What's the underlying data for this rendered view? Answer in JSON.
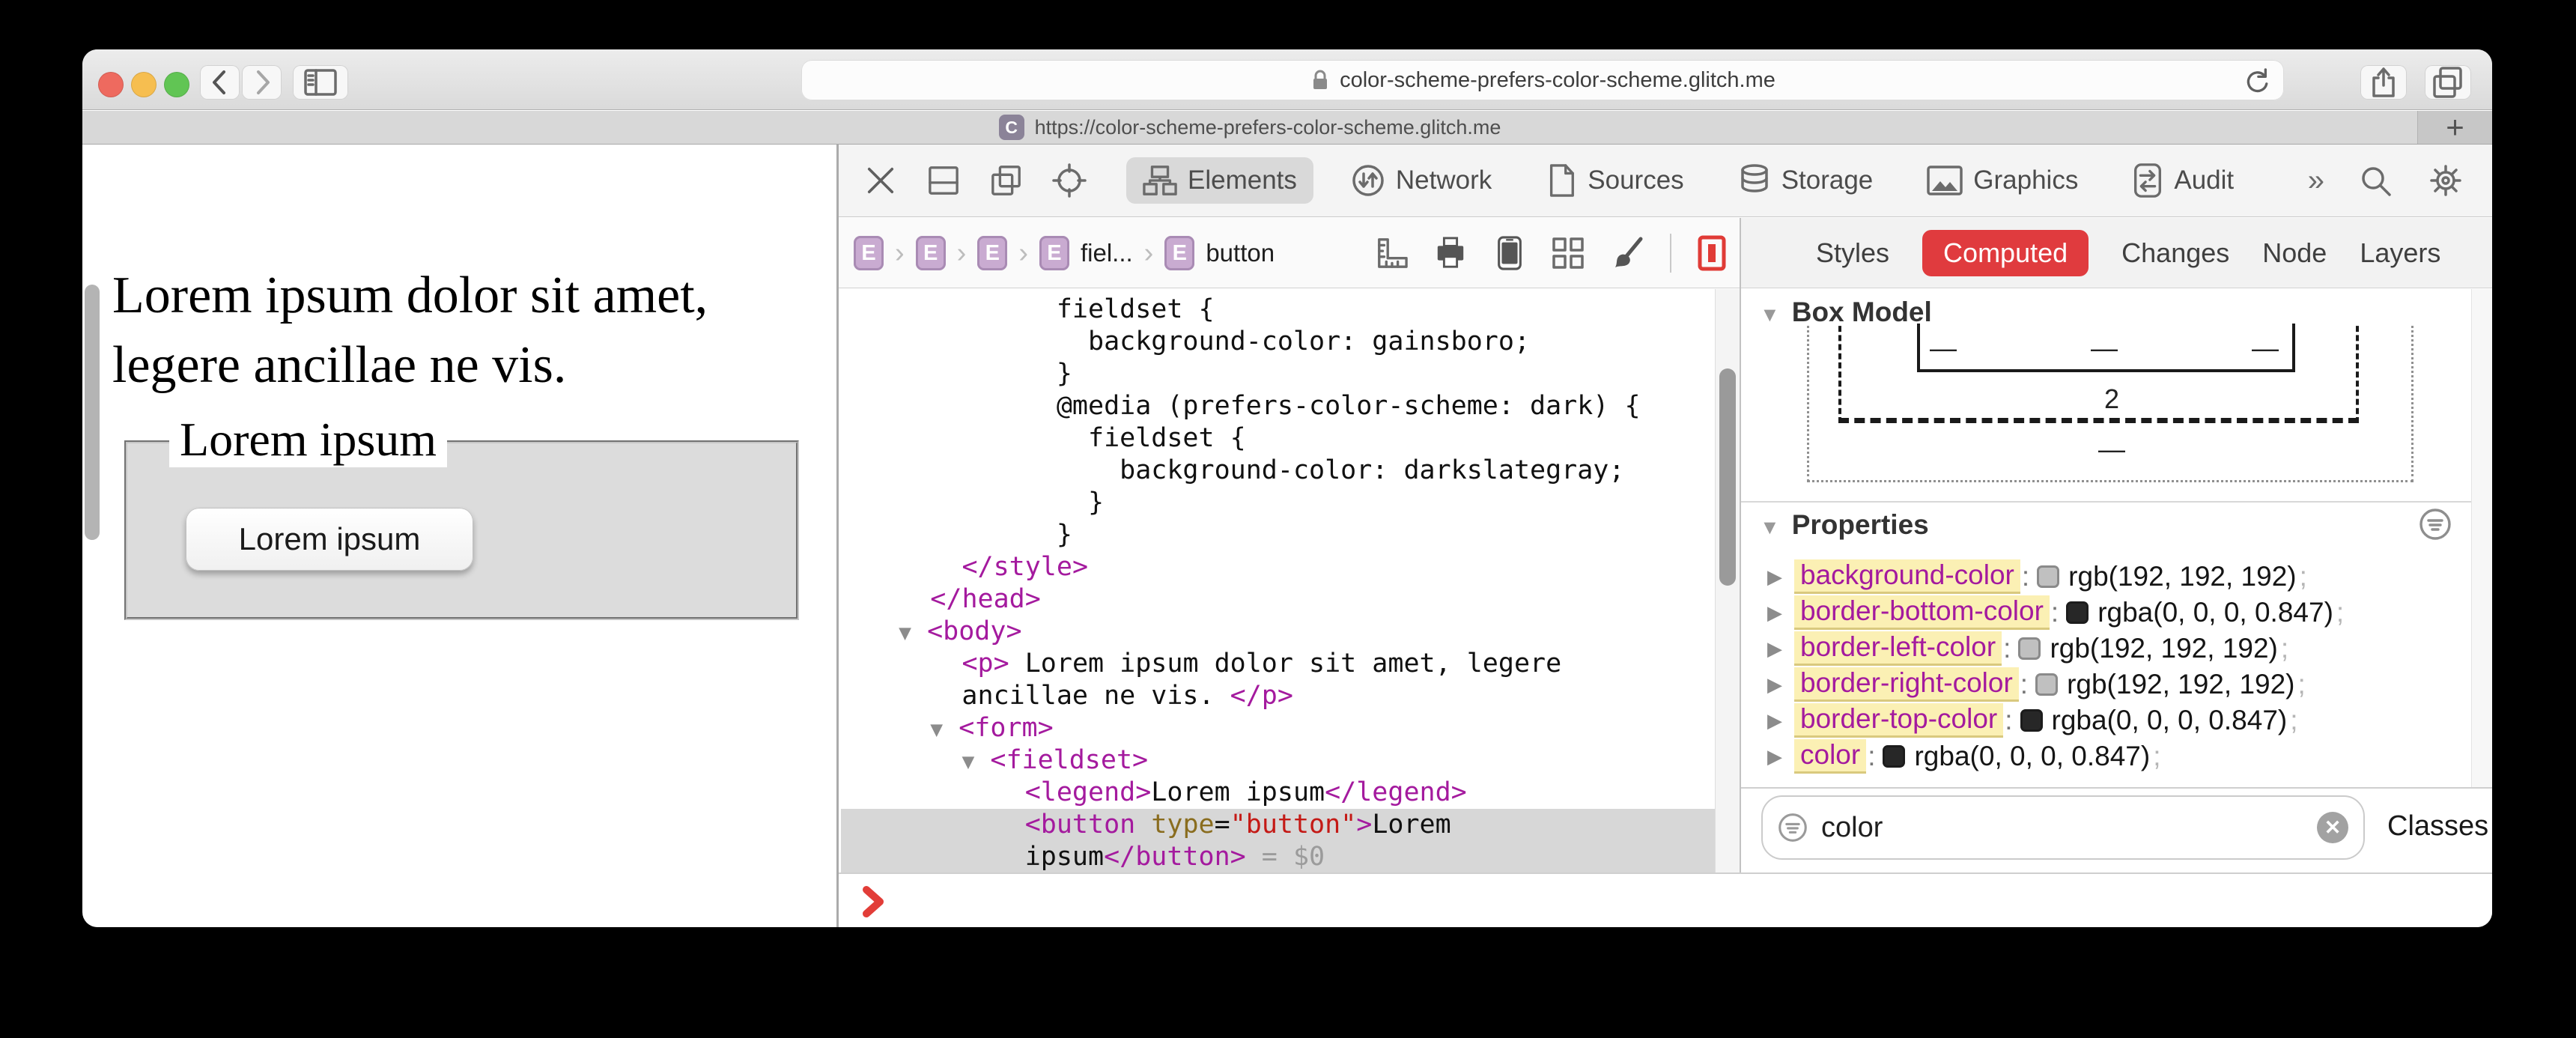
{
  "browser": {
    "url_bar": {
      "domain": "color-scheme-prefers-color-scheme.glitch.me"
    },
    "tab": {
      "favicon_letter": "C",
      "url": "https://color-scheme-prefers-color-scheme.glitch.me"
    },
    "new_tab_label": "+"
  },
  "page": {
    "paragraph": "Lorem ipsum dolor sit amet, legere ancillae ne vis.",
    "fieldset_legend": "Lorem ipsum",
    "button_label": "Lorem ipsum"
  },
  "devtools": {
    "tabs": [
      {
        "label": "Elements",
        "selected": true
      },
      {
        "label": "Network"
      },
      {
        "label": "Sources"
      },
      {
        "label": "Storage"
      },
      {
        "label": "Graphics"
      },
      {
        "label": "Audit"
      }
    ],
    "more_tabs_glyph": "»",
    "breadcrumb": {
      "separator": "›",
      "items": [
        {
          "badge": "E"
        },
        {
          "badge": "E"
        },
        {
          "badge": "E"
        },
        {
          "badge": "E",
          "label": "fiel..."
        },
        {
          "badge": "E",
          "label": "button"
        }
      ]
    },
    "code": {
      "lines": [
        {
          "segs": [
            [
              "k",
              "            fieldset {"
            ]
          ]
        },
        {
          "segs": [
            [
              "k",
              "              background-color: gainsboro;"
            ]
          ]
        },
        {
          "segs": [
            [
              "k",
              "            }"
            ]
          ]
        },
        {
          "segs": [
            [
              "k",
              "            @media (prefers-color-scheme: dark) {"
            ]
          ]
        },
        {
          "segs": [
            [
              "k",
              "              fieldset {"
            ]
          ]
        },
        {
          "segs": [
            [
              "k",
              "                background-color: darkslategray;"
            ]
          ]
        },
        {
          "segs": [
            [
              "k",
              "              }"
            ]
          ]
        },
        {
          "segs": [
            [
              "k",
              "            }"
            ]
          ]
        },
        {
          "segs": [
            [
              "k",
              "      "
            ],
            [
              "t",
              "</style>"
            ]
          ]
        },
        {
          "segs": [
            [
              "k",
              "    "
            ],
            [
              "t",
              "</head>"
            ]
          ]
        },
        {
          "segs": [
            [
              "k",
              "  "
            ],
            [
              "y",
              "▼"
            ],
            [
              "k",
              " "
            ],
            [
              "t",
              "<body>"
            ]
          ]
        },
        {
          "segs": [
            [
              "k",
              "      "
            ],
            [
              "t",
              "<p>"
            ],
            [
              "k",
              " Lorem ipsum dolor sit amet, legere"
            ]
          ]
        },
        {
          "segs": [
            [
              "k",
              "      ancillae ne vis. "
            ],
            [
              "t",
              "</p>"
            ]
          ]
        },
        {
          "segs": [
            [
              "k",
              "    "
            ],
            [
              "y",
              "▼"
            ],
            [
              "k",
              " "
            ],
            [
              "t",
              "<form>"
            ]
          ]
        },
        {
          "segs": [
            [
              "k",
              "      "
            ],
            [
              "y",
              "▼"
            ],
            [
              "k",
              " "
            ],
            [
              "t",
              "<fieldset>"
            ]
          ]
        },
        {
          "segs": [
            [
              "k",
              "          "
            ],
            [
              "t",
              "<legend>"
            ],
            [
              "k",
              "Lorem ipsum"
            ],
            [
              "t",
              "</legend>"
            ]
          ]
        },
        {
          "hl": true,
          "segs": [
            [
              "k",
              "          "
            ],
            [
              "t",
              "<button"
            ],
            [
              "k",
              " "
            ],
            [
              "a",
              "type"
            ],
            [
              "k",
              "="
            ],
            [
              "s",
              "\"button\""
            ],
            [
              "t",
              ">"
            ],
            [
              "k",
              "Lorem"
            ]
          ]
        },
        {
          "hl": true,
          "segs": [
            [
              "k",
              "          ipsum"
            ],
            [
              "t",
              "</button>"
            ],
            [
              "d",
              " = $0"
            ]
          ]
        }
      ]
    }
  },
  "sidebar": {
    "tabs": [
      {
        "label": "Styles"
      },
      {
        "label": "Computed",
        "selected": true
      },
      {
        "label": "Changes"
      },
      {
        "label": "Node"
      },
      {
        "label": "Layers"
      }
    ],
    "box_model": {
      "title": "Box Model",
      "border_bottom_value": "2",
      "dash": "—"
    },
    "properties": {
      "title": "Properties",
      "separator": ":",
      "terminator": ";",
      "disclosure_closed": "▶",
      "rows": [
        {
          "name": "background-color",
          "value": "rgb(192, 192, 192)",
          "swatch": "#c0c0c0"
        },
        {
          "name": "border-bottom-color",
          "value": "rgba(0, 0, 0, 0.847)",
          "swatch": "#272727"
        },
        {
          "name": "border-left-color",
          "value": "rgb(192, 192, 192)",
          "swatch": "#c0c0c0"
        },
        {
          "name": "border-right-color",
          "value": "rgb(192, 192, 192)",
          "swatch": "#c0c0c0"
        },
        {
          "name": "border-top-color",
          "value": "rgba(0, 0, 0, 0.847)",
          "swatch": "#272727"
        },
        {
          "name": "color",
          "value": "rgba(0, 0, 0, 0.847)",
          "swatch": "#272727"
        }
      ]
    },
    "filter": {
      "value": "color",
      "classes_label": "Classes"
    }
  },
  "glyphs": {
    "disclosure_open": "▼"
  },
  "colors": {
    "accent_red": "#e03b3e",
    "tag_magenta": "#a41a9e",
    "gainsboro": "#dcdcdc",
    "highlight_yellow": "#fbf0b4"
  }
}
